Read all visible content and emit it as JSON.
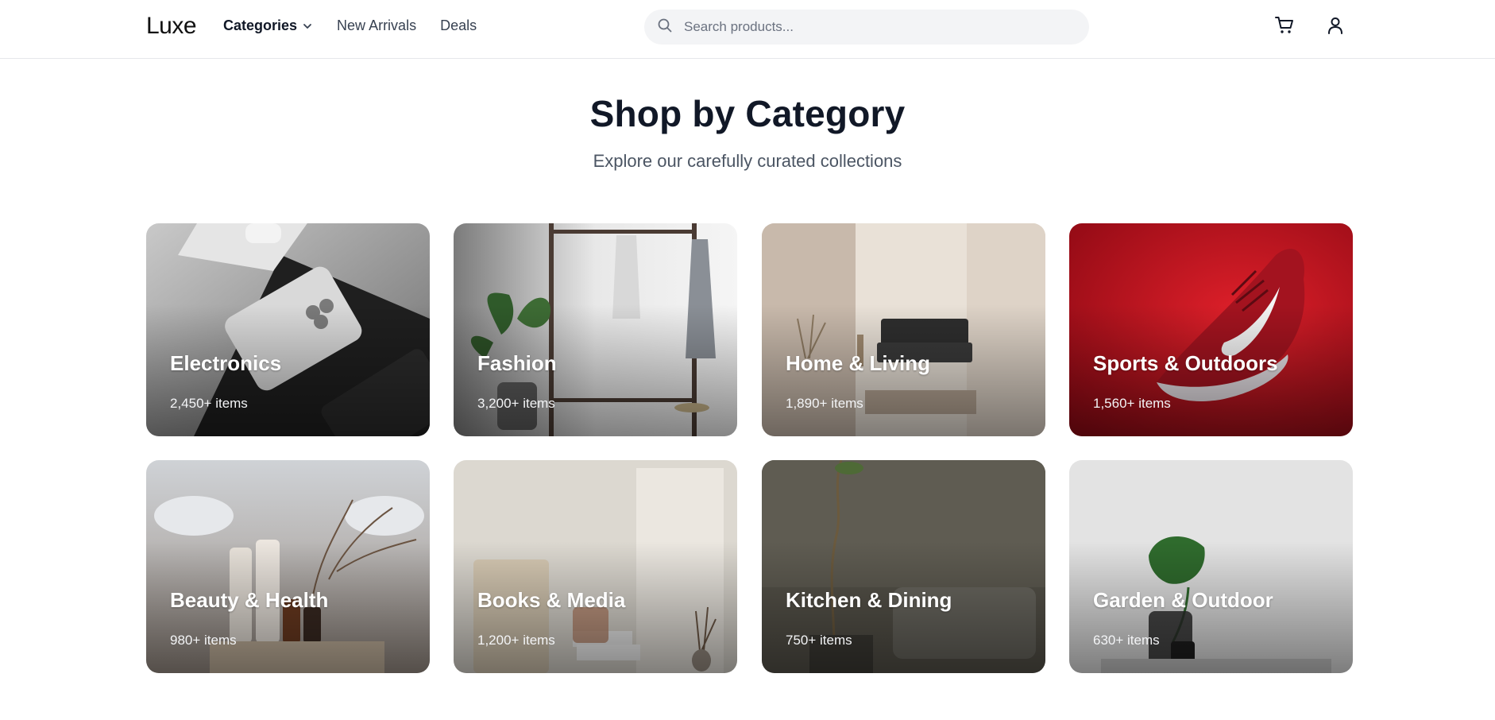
{
  "header": {
    "logo": "Luxe",
    "nav": [
      {
        "label": "Categories",
        "has_dropdown": true
      },
      {
        "label": "New Arrivals"
      },
      {
        "label": "Deals"
      }
    ],
    "search": {
      "placeholder": "Search products...",
      "icon": "search-icon"
    },
    "actions": [
      {
        "icon": "cart-icon"
      },
      {
        "icon": "user-icon"
      }
    ]
  },
  "hero": {
    "title": "Shop by Category",
    "subtitle": "Explore our carefully curated collections"
  },
  "categories": [
    {
      "name": "Electronics",
      "count": "2,450+ items"
    },
    {
      "name": "Fashion",
      "count": "3,200+ items"
    },
    {
      "name": "Home & Living",
      "count": "1,890+ items"
    },
    {
      "name": "Sports & Outdoors",
      "count": "1,560+ items"
    },
    {
      "name": "Beauty & Health",
      "count": "980+ items"
    },
    {
      "name": "Books & Media",
      "count": "1,200+ items"
    },
    {
      "name": "Kitchen & Dining",
      "count": "750+ items"
    },
    {
      "name": "Garden & Outdoor",
      "count": "630+ items"
    }
  ],
  "colors": {
    "accent": "#111827",
    "muted": "#4b5563",
    "search_bg": "#f3f4f6",
    "border": "#e5e7eb"
  }
}
